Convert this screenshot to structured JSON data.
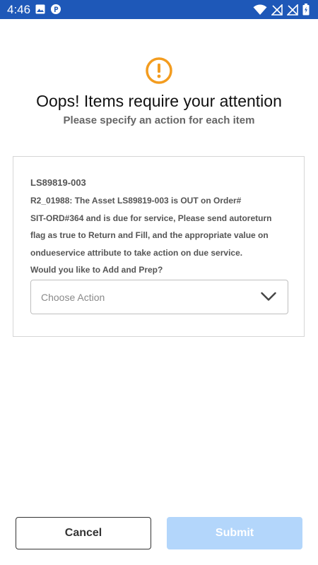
{
  "status_bar": {
    "time": "4:46",
    "background": "#1e58b8",
    "left_icons": [
      "image-icon",
      "parking-p-icon"
    ],
    "right_icons": [
      "wifi-icon",
      "signal-off-icon",
      "signal-off-icon",
      "battery-icon"
    ]
  },
  "dialog": {
    "icon": "warning-circle-icon",
    "accent_color": "#f39c1f",
    "title": "Oops! Items require your attention",
    "subtitle": "Please specify an action for each item"
  },
  "item": {
    "id": "LS89819-003",
    "message_lines": [
      "R2_01988: The Asset LS89819-003 is OUT on Order#",
      "SIT-ORD#364 and is due for service, Please send autoreturn",
      "flag as true to Return and Fill, and the appropriate value on",
      "ondueservice attribute to take action on due service.",
      "Would you like to Add and Prep?"
    ],
    "action_select": {
      "placeholder": "Choose Action",
      "icon": "chevron-down-icon"
    }
  },
  "footer": {
    "cancel_label": "Cancel",
    "submit_label": "Submit",
    "submit_color": "#b3d6fb"
  }
}
